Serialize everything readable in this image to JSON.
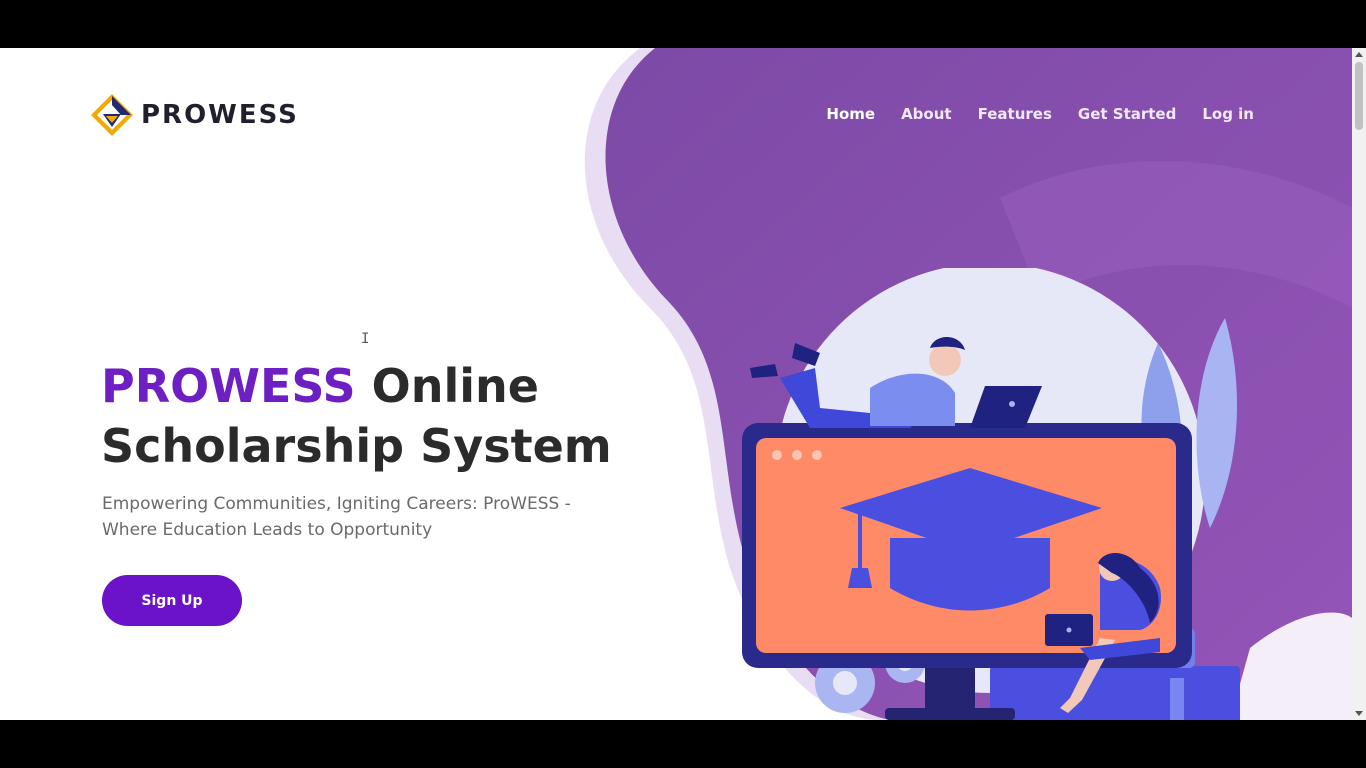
{
  "brand": {
    "logo_text": "PROWESS",
    "logo_icon": "diamond-logo-icon"
  },
  "nav": {
    "items": [
      {
        "label": "Home",
        "active": true
      },
      {
        "label": "About",
        "active": false
      },
      {
        "label": "Features",
        "active": false
      },
      {
        "label": "Get Started",
        "active": false
      },
      {
        "label": "Log in",
        "active": false
      }
    ]
  },
  "hero": {
    "title_brand": "PROWESS",
    "title_rest": " Online Scholarship System",
    "subtitle": "Empowering Communities, Igniting Careers: ProWESS - Where Education Leads to Opportunity",
    "cta_label": "Sign Up"
  },
  "illustration": {
    "icon": "graduation-cap-icon"
  },
  "colors": {
    "brand_purple": "#6e1fc3",
    "button_purple": "#6a13c8",
    "blob_purple": "#8a4fb0",
    "screen_orange": "#ff8a68",
    "monitor_navy": "#2a2a8c",
    "logo_gold": "#f2a900",
    "logo_navy": "#1e2a78"
  }
}
